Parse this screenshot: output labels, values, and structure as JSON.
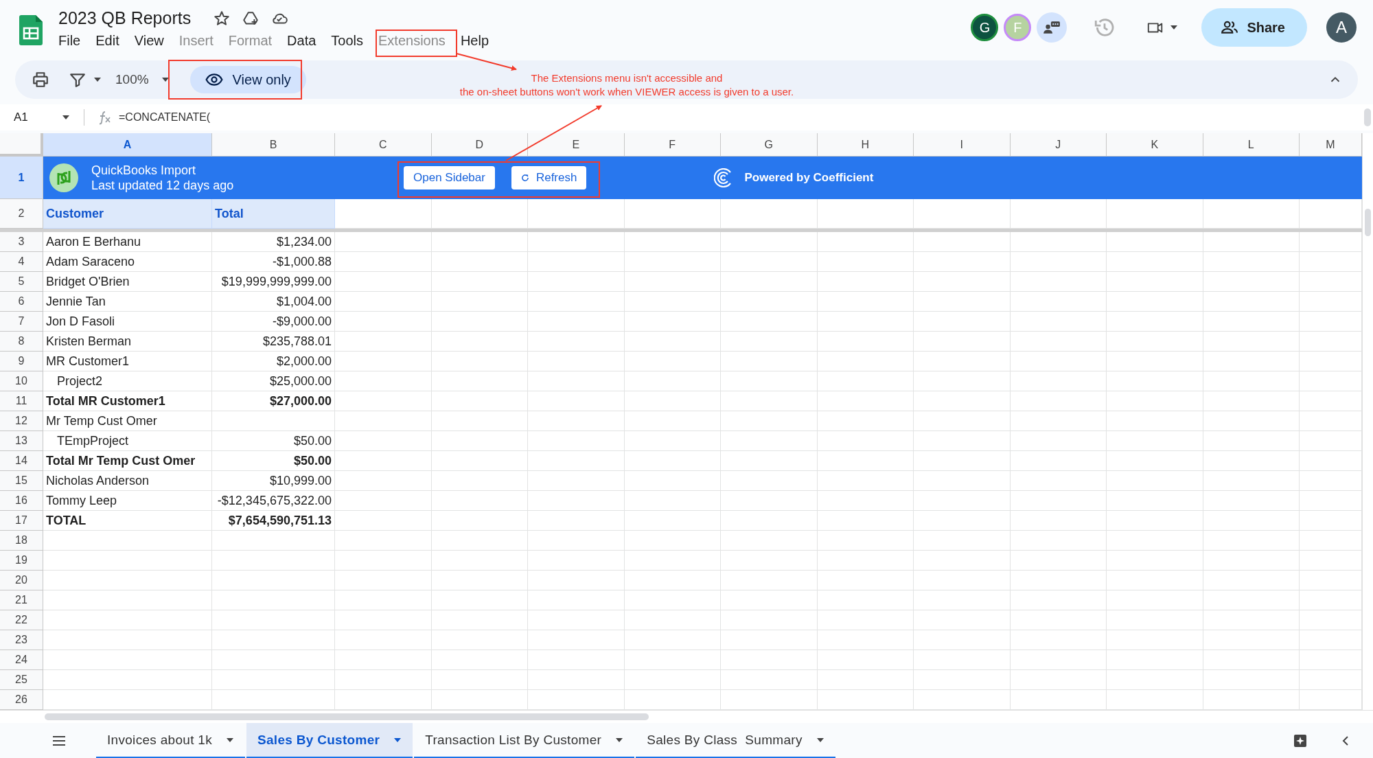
{
  "document": {
    "title": "2023 QB Reports"
  },
  "menu": [
    {
      "label": "File",
      "disabled": false
    },
    {
      "label": "Edit",
      "disabled": false
    },
    {
      "label": "View",
      "disabled": false
    },
    {
      "label": "Insert",
      "disabled": true
    },
    {
      "label": "Format",
      "disabled": true
    },
    {
      "label": "Data",
      "disabled": false
    },
    {
      "label": "Tools",
      "disabled": false
    },
    {
      "label": "Extensions",
      "disabled": true
    },
    {
      "label": "Help",
      "disabled": false
    }
  ],
  "header_actions": {
    "avatars": [
      {
        "initial": "G",
        "color": "#0d5240"
      },
      {
        "initial": "F",
        "color": "#b6d3a0"
      }
    ],
    "share_button": "Share",
    "account_initial": "A"
  },
  "toolbar": {
    "zoom": "100%",
    "mode_button": "View only"
  },
  "annotation": {
    "lines": [
      "The Extensions menu isn't accessible and",
      "the on-sheet buttons won't work when VIEWER access is given to a user."
    ]
  },
  "formula_bar": {
    "cell_reference": "A1",
    "formula": "=CONCATENATE("
  },
  "sheet": {
    "columns": [
      {
        "label": "A",
        "selected": true
      },
      {
        "label": "B",
        "selected": false
      },
      {
        "label": "C",
        "selected": false
      },
      {
        "label": "D",
        "selected": false
      },
      {
        "label": "E",
        "selected": false
      },
      {
        "label": "F",
        "selected": false
      },
      {
        "label": "G",
        "selected": false
      },
      {
        "label": "H",
        "selected": false
      },
      {
        "label": "I",
        "selected": false
      },
      {
        "label": "J",
        "selected": false
      },
      {
        "label": "K",
        "selected": false
      },
      {
        "label": "L",
        "selected": false
      },
      {
        "label": "M",
        "selected": false
      }
    ],
    "banner": {
      "row_number": "1",
      "selected": true,
      "title": "QuickBooks Import",
      "subtitle": "Last updated 12 days ago",
      "buttons": [
        "Open Sidebar",
        "Refresh"
      ],
      "credit": "Powered by Coefficient"
    },
    "header_row": {
      "row_number": "2",
      "cells": [
        "Customer",
        "Total"
      ]
    },
    "rows": [
      {
        "number": "3",
        "customer": "Aaron E Berhanu",
        "total": "$1,234.00",
        "kind": "item"
      },
      {
        "number": "4",
        "customer": "Adam Saraceno",
        "total": "-$1,000.88",
        "kind": "item"
      },
      {
        "number": "5",
        "customer": "Bridget O'Brien",
        "total": "$19,999,999,999.00",
        "kind": "item"
      },
      {
        "number": "6",
        "customer": "Jennie Tan",
        "total": "$1,004.00",
        "kind": "item"
      },
      {
        "number": "7",
        "customer": "Jon D Fasoli",
        "total": "-$9,000.00",
        "kind": "item"
      },
      {
        "number": "8",
        "customer": "Kristen Berman",
        "total": "$235,788.01",
        "kind": "item"
      },
      {
        "number": "9",
        "customer": "MR Customer1",
        "total": "$2,000.00",
        "kind": "item",
        "children": [
          {
            "number": "10",
            "customer": "Project2",
            "total": "$25,000.00"
          }
        ]
      },
      {
        "number": "11",
        "customer": "Total MR Customer1",
        "total": "$27,000.00",
        "kind": "total"
      },
      {
        "number": "12",
        "customer": "Mr Temp Cust Omer",
        "kind": "item",
        "children": [
          {
            "number": "13",
            "customer": "TEmpProject",
            "total": "$50.00"
          }
        ]
      },
      {
        "number": "14",
        "customer": "Total Mr Temp Cust Omer",
        "total": "$50.00",
        "kind": "total"
      },
      {
        "number": "15",
        "customer": "Nicholas Anderson",
        "total": "$10,999.00",
        "kind": "item"
      },
      {
        "number": "16",
        "customer": "Tommy Leep",
        "total": "-$12,345,675,322.00",
        "kind": "item"
      },
      {
        "number": "17",
        "customer": "TOTAL",
        "total": "$7,654,590,751.13",
        "kind": "total"
      }
    ],
    "empty_rows": [
      "18",
      "19",
      "20",
      "21",
      "22",
      "23",
      "24",
      "25",
      "26"
    ]
  },
  "sheet_tabs": [
    {
      "label": "Invoices about 1k",
      "selected": false
    },
    {
      "label": "Sales By Customer",
      "selected": true
    },
    {
      "label": "Transaction List By Customer",
      "selected": false
    },
    {
      "label": "Sales By Class  Summary",
      "selected": false
    }
  ]
}
